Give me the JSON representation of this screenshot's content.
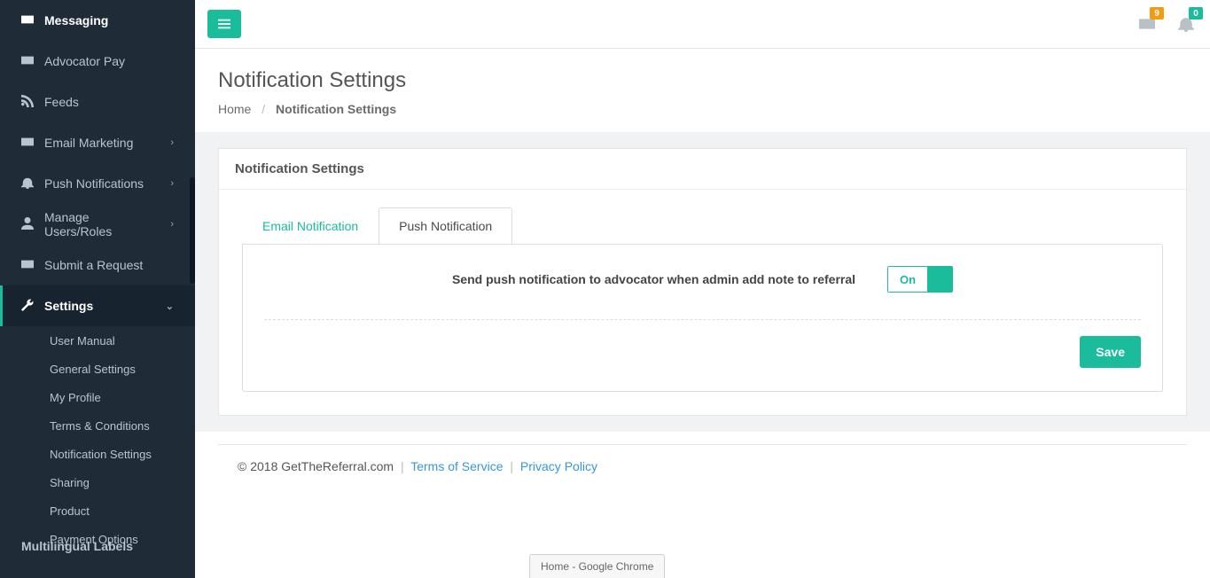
{
  "sidebar": {
    "items": [
      {
        "icon": "envelope",
        "label": "Messaging",
        "highlight": true
      },
      {
        "icon": "envelope",
        "label": "Advocator Pay"
      },
      {
        "icon": "rss",
        "label": "Feeds"
      },
      {
        "icon": "envelope",
        "label": "Email Marketing",
        "expandable": true
      },
      {
        "icon": "bell",
        "label": "Push Notifications",
        "expandable": true
      },
      {
        "icon": "user",
        "label": "Manage Users/Roles",
        "expandable": true
      },
      {
        "icon": "envelope",
        "label": "Submit a Request"
      },
      {
        "icon": "wrench",
        "label": "Settings",
        "active": true,
        "expandable": true,
        "expanded": true,
        "children": [
          {
            "label": "User Manual"
          },
          {
            "label": "General Settings"
          },
          {
            "label": "My Profile"
          },
          {
            "label": "Terms & Conditions"
          },
          {
            "label": "Notification Settings"
          },
          {
            "label": "Sharing"
          },
          {
            "label": "Product"
          },
          {
            "label": "Payment Options"
          }
        ]
      }
    ],
    "bottom_label": "Multilingual Labels"
  },
  "topbar": {
    "mail_badge": "9",
    "bell_badge": "0"
  },
  "page": {
    "title": "Notification Settings",
    "breadcrumb_home": "Home",
    "breadcrumb_current": "Notification Settings"
  },
  "panel": {
    "header": "Notification Settings",
    "tabs": [
      {
        "label": "Email Notification",
        "active": false
      },
      {
        "label": "Push Notification",
        "active": true
      }
    ],
    "option_label": "Send push notification to advocator when admin add note to referral",
    "toggle_state": "On",
    "save_label": "Save"
  },
  "footer": {
    "copyright": "© 2018 GetTheReferral.com",
    "tos": "Terms of Service",
    "privacy": "Privacy Policy"
  },
  "browser_tab": "Home - Google Chrome"
}
